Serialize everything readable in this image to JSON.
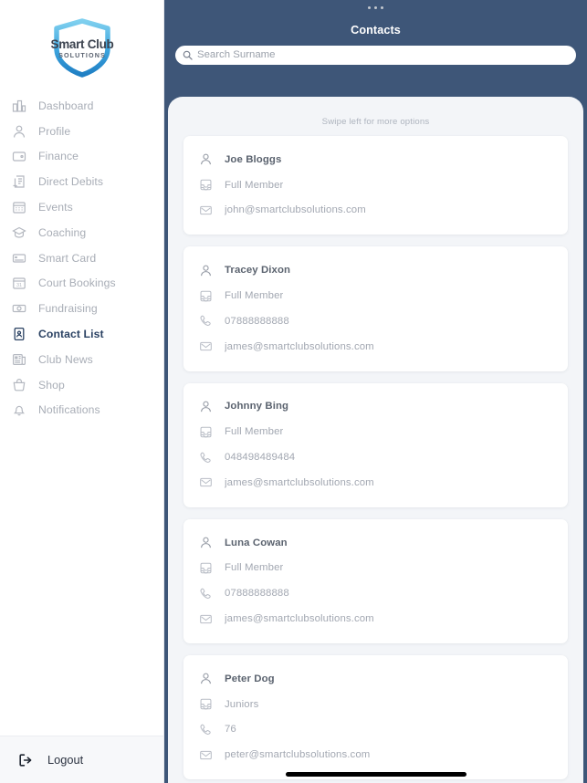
{
  "colors": {
    "header_navy": "#3e5678",
    "active_nav": "#2b4263",
    "sheet_bg": "#f3f5f8",
    "card_bg": "#ffffff",
    "muted_text": "#a3a8b2",
    "logo_blue": "#3fa9dd"
  },
  "sidebar": {
    "logo": {
      "icon": "shield-logo",
      "line1": "Smart Club",
      "line2": "SOLUTIONS"
    },
    "items": [
      {
        "label": "Dashboard",
        "icon": "bar-chart-icon",
        "active": false
      },
      {
        "label": "Profile",
        "icon": "person-icon",
        "active": false
      },
      {
        "label": "Finance",
        "icon": "wallet-icon",
        "active": false
      },
      {
        "label": "Direct Debits",
        "icon": "invoice-icon",
        "active": false
      },
      {
        "label": "Events",
        "icon": "calendar-icon",
        "active": false
      },
      {
        "label": "Coaching",
        "icon": "graduation-icon",
        "active": false
      },
      {
        "label": "Smart Card",
        "icon": "card-icon",
        "active": false
      },
      {
        "label": "Court Bookings",
        "icon": "calendar-31-icon",
        "active": false
      },
      {
        "label": "Fundraising",
        "icon": "money-icon",
        "active": false
      },
      {
        "label": "Contact List",
        "icon": "contact-book-icon",
        "active": true
      },
      {
        "label": "Club News",
        "icon": "newspaper-icon",
        "active": false
      },
      {
        "label": "Shop",
        "icon": "basket-icon",
        "active": false
      },
      {
        "label": "Notifications",
        "icon": "bell-icon",
        "active": false
      }
    ],
    "logout": {
      "label": "Logout",
      "icon": "logout-icon"
    }
  },
  "phone": {
    "header": {
      "title": "Contacts"
    },
    "search": {
      "icon": "search-icon",
      "value": "",
      "placeholder": "Search Surname"
    },
    "swipe_hint": "Swipe left for more options",
    "contacts": [
      {
        "name": "Joe Bloggs",
        "membership": "Full Member",
        "phone": null,
        "email": "john@smartclubsolutions.com"
      },
      {
        "name": "Tracey Dixon",
        "membership": "Full Member",
        "phone": "07888888888",
        "email": "james@smartclubsolutions.com"
      },
      {
        "name": "Johnny Bing",
        "membership": "Full Member",
        "phone": "048498489484",
        "email": "james@smartclubsolutions.com"
      },
      {
        "name": "Luna Cowan",
        "membership": "Full Member",
        "phone": "07888888888",
        "email": "james@smartclubsolutions.com"
      },
      {
        "name": "Peter Dog",
        "membership": "Juniors",
        "phone": "76",
        "email": "peter@smartclubsolutions.com"
      }
    ],
    "icons": {
      "name": "person-icon",
      "membership": "tray-icon",
      "phone": "phone-icon",
      "email": "envelope-icon"
    }
  }
}
